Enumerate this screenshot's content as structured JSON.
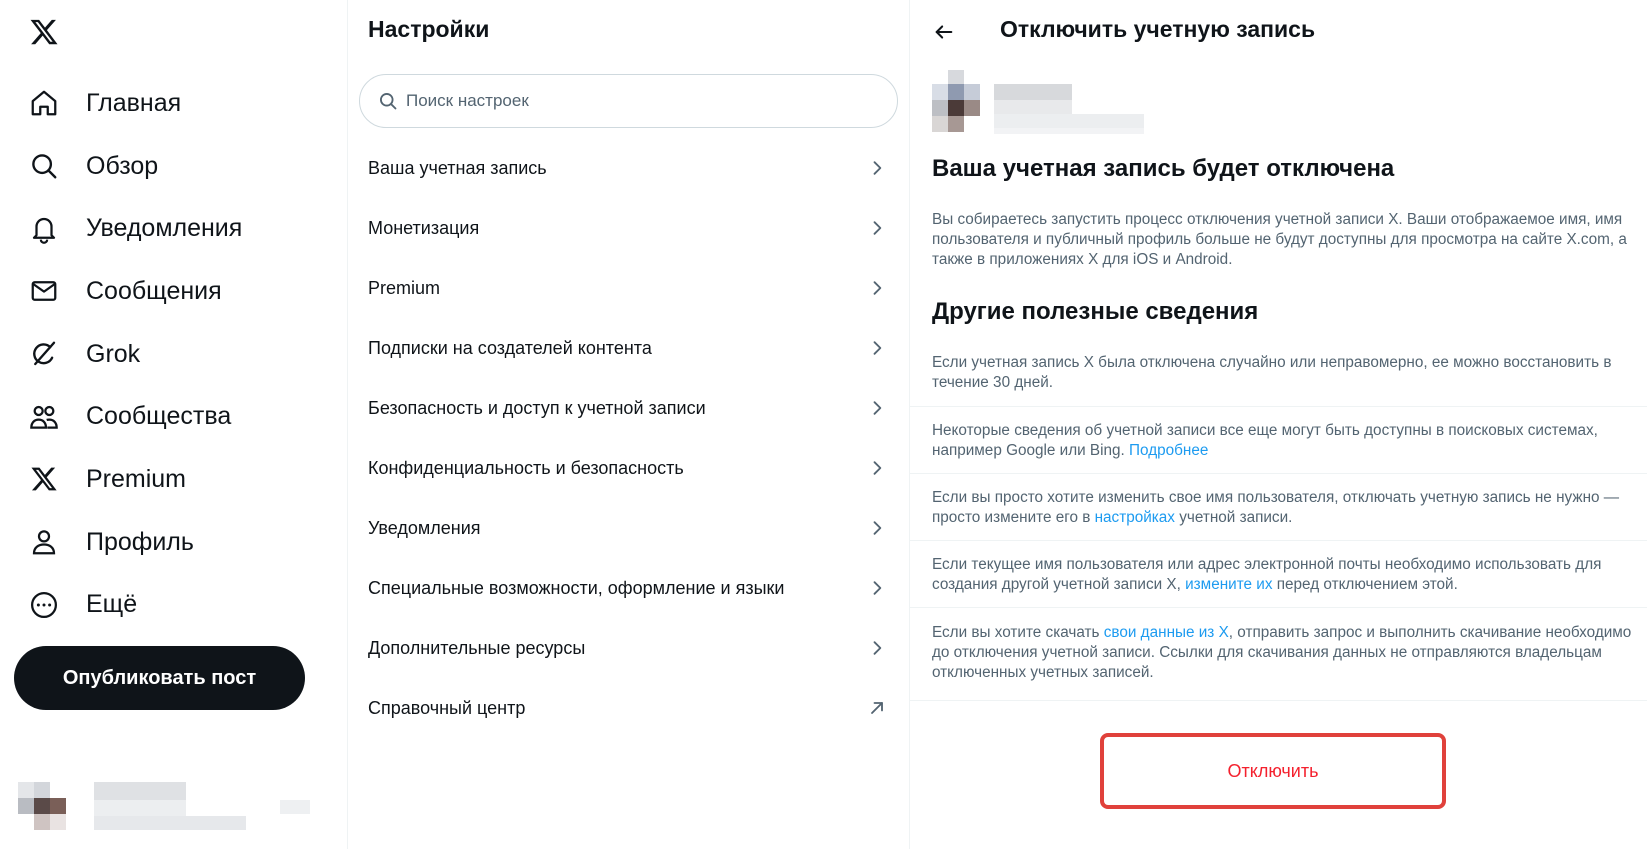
{
  "nav": {
    "items": [
      {
        "label": "Главная",
        "icon": "home-icon"
      },
      {
        "label": "Обзор",
        "icon": "search-icon"
      },
      {
        "label": "Уведомления",
        "icon": "bell-icon"
      },
      {
        "label": "Сообщения",
        "icon": "envelope-icon"
      },
      {
        "label": "Grok",
        "icon": "grok-icon"
      },
      {
        "label": "Сообщества",
        "icon": "communities-icon"
      },
      {
        "label": "Premium",
        "icon": "x-logo-icon"
      },
      {
        "label": "Профиль",
        "icon": "person-icon"
      },
      {
        "label": "Ещё",
        "icon": "more-circle-icon"
      }
    ],
    "post_label": "Опубликовать пост"
  },
  "settings": {
    "title": "Настройки",
    "search_placeholder": "Поиск настроек",
    "items": [
      {
        "label": "Ваша учетная запись",
        "icon": "chevron-right-icon"
      },
      {
        "label": "Монетизация",
        "icon": "chevron-right-icon"
      },
      {
        "label": "Premium",
        "icon": "chevron-right-icon"
      },
      {
        "label": "Подписки на создателей контента",
        "icon": "chevron-right-icon"
      },
      {
        "label": "Безопасность и доступ к учетной записи",
        "icon": "chevron-right-icon"
      },
      {
        "label": "Конфиденциальность и безопасность",
        "icon": "chevron-right-icon"
      },
      {
        "label": "Уведомления",
        "icon": "chevron-right-icon"
      },
      {
        "label": "Специальные возможности, оформление и языки",
        "icon": "chevron-right-icon"
      },
      {
        "label": "Дополнительные ресурсы",
        "icon": "chevron-right-icon"
      },
      {
        "label": "Справочный центр",
        "icon": "external-arrow-icon"
      }
    ]
  },
  "detail": {
    "title": "Отключить учетную запись",
    "heading1": "Ваша учетная запись будет отключена",
    "para1": "Вы собираетесь запустить процесс отключения учетной записи X. Ваши отображаемое имя, имя пользователя и публичный профиль больше не будут доступны для просмотра на сайте X.com, а также в приложениях X для iOS и Android.",
    "heading2": "Другие полезные сведения",
    "info1": "Если учетная запись X была отключена случайно или неправомерно, ее можно восстановить в течение 30 дней.",
    "info2_pre": "Некоторые сведения об учетной записи все еще могут быть доступны в поисковых системах, например Google или Bing. ",
    "info2_link": "Подробнее",
    "info3_pre": "Если вы просто хотите изменить свое имя пользователя, отключать учетную запись не нужно — просто измените его в ",
    "info3_link": "настройках",
    "info3_post": " учетной записи.",
    "info4_pre": "Если текущее имя пользователя или адрес электронной почты необходимо использовать для создания другой учетной записи X, ",
    "info4_link": "измените их",
    "info4_post": " перед отключением этой.",
    "info5_pre": "Если вы хотите скачать ",
    "info5_link": "свои данные из X",
    "info5_post": ", отправить запрос и выполнить скачивание необходимо до отключения учетной записи. Ссылки для скачивания данных не отправляются владельцам отключенных учетных записей.",
    "deactivate_label": "Отключить"
  },
  "colors": {
    "text": "#0f1419",
    "secondary": "#536471",
    "link": "#1d9bf0",
    "danger": "#f4212e",
    "highlight_border": "#e0413b"
  }
}
